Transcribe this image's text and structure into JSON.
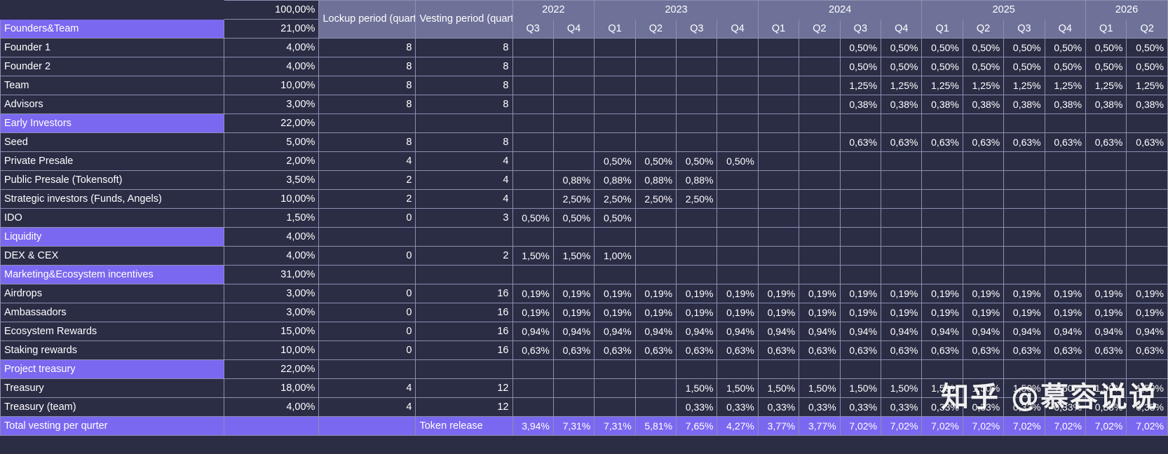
{
  "header": {
    "total_label": "100,00%",
    "lockup_label": "Lockup period (quarters)",
    "vesting_label": "Vesting period (quarters)",
    "years": [
      {
        "label": "2022",
        "span": 2
      },
      {
        "label": "2023",
        "span": 4
      },
      {
        "label": "2024",
        "span": 4
      },
      {
        "label": "2025",
        "span": 4
      },
      {
        "label": "2026",
        "span": 2
      }
    ],
    "quarters": [
      "Q3",
      "Q4",
      "Q1",
      "Q2",
      "Q3",
      "Q4",
      "Q1",
      "Q2",
      "Q3",
      "Q4",
      "Q1",
      "Q2",
      "Q3",
      "Q4",
      "Q1",
      "Q2"
    ]
  },
  "colors": {
    "accent": "#7b68f0",
    "header_band": "#6e7299",
    "cell_bg": "#2b2d45",
    "grid_line": "#8b8fb0"
  },
  "watermark": "知乎 @慕容说说",
  "total_row": {
    "label": "Total vesting per qurter",
    "allocation": "",
    "lockup": "",
    "vesting": "Token release",
    "quarters": [
      "3,94%",
      "7,31%",
      "7,31%",
      "5,81%",
      "7,65%",
      "4,27%",
      "3,77%",
      "3,77%",
      "7,02%",
      "7,02%",
      "7,02%",
      "7,02%",
      "7,02%",
      "7,02%",
      "7,02%",
      "7,02%"
    ]
  },
  "rows": [
    {
      "type": "category",
      "label": "Founders&Team",
      "allocation": "21,00%",
      "lockup": "",
      "vesting": "",
      "quarters": [
        "",
        "",
        "",
        "",
        "",
        "",
        "",
        "",
        "",
        "",
        "",
        "",
        "",
        "",
        "",
        ""
      ]
    },
    {
      "type": "item",
      "label": "Founder 1",
      "allocation": "4,00%",
      "lockup": "8",
      "vesting": "8",
      "quarters": [
        "",
        "",
        "",
        "",
        "",
        "",
        "",
        "",
        "0,50%",
        "0,50%",
        "0,50%",
        "0,50%",
        "0,50%",
        "0,50%",
        "0,50%",
        "0,50%"
      ]
    },
    {
      "type": "item",
      "label": "Founder 2",
      "allocation": "4,00%",
      "lockup": "8",
      "vesting": "8",
      "quarters": [
        "",
        "",
        "",
        "",
        "",
        "",
        "",
        "",
        "0,50%",
        "0,50%",
        "0,50%",
        "0,50%",
        "0,50%",
        "0,50%",
        "0,50%",
        "0,50%"
      ]
    },
    {
      "type": "item",
      "label": "Team",
      "allocation": "10,00%",
      "lockup": "8",
      "vesting": "8",
      "quarters": [
        "",
        "",
        "",
        "",
        "",
        "",
        "",
        "",
        "1,25%",
        "1,25%",
        "1,25%",
        "1,25%",
        "1,25%",
        "1,25%",
        "1,25%",
        "1,25%"
      ]
    },
    {
      "type": "item",
      "label": "Advisors",
      "allocation": "3,00%",
      "lockup": "8",
      "vesting": "8",
      "quarters": [
        "",
        "",
        "",
        "",
        "",
        "",
        "",
        "",
        "0,38%",
        "0,38%",
        "0,38%",
        "0,38%",
        "0,38%",
        "0,38%",
        "0,38%",
        "0,38%"
      ]
    },
    {
      "type": "category",
      "label": "Early Investors",
      "allocation": "22,00%",
      "lockup": "",
      "vesting": "",
      "quarters": [
        "",
        "",
        "",
        "",
        "",
        "",
        "",
        "",
        "",
        "",
        "",
        "",
        "",
        "",
        "",
        ""
      ]
    },
    {
      "type": "item",
      "label": "Seed",
      "allocation": "5,00%",
      "lockup": "8",
      "vesting": "8",
      "quarters": [
        "",
        "",
        "",
        "",
        "",
        "",
        "",
        "",
        "0,63%",
        "0,63%",
        "0,63%",
        "0,63%",
        "0,63%",
        "0,63%",
        "0,63%",
        "0,63%"
      ]
    },
    {
      "type": "item",
      "label": "Private Presale",
      "allocation": "2,00%",
      "lockup": "4",
      "vesting": "4",
      "quarters": [
        "",
        "",
        "0,50%",
        "0,50%",
        "0,50%",
        "0,50%",
        "",
        "",
        "",
        "",
        "",
        "",
        "",
        "",
        "",
        ""
      ]
    },
    {
      "type": "item",
      "label": "Public Presale  (Tokensoft)",
      "allocation": "3,50%",
      "lockup": "2",
      "vesting": "4",
      "quarters": [
        "",
        "0,88%",
        "0,88%",
        "0,88%",
        "0,88%",
        "",
        "",
        "",
        "",
        "",
        "",
        "",
        "",
        "",
        "",
        ""
      ]
    },
    {
      "type": "item",
      "label": "Strategic investors (Funds, Angels)",
      "allocation": "10,00%",
      "lockup": "2",
      "vesting": "4",
      "quarters": [
        "",
        "2,50%",
        "2,50%",
        "2,50%",
        "2,50%",
        "",
        "",
        "",
        "",
        "",
        "",
        "",
        "",
        "",
        "",
        ""
      ]
    },
    {
      "type": "item",
      "label": "IDO",
      "allocation": "1,50%",
      "lockup": "0",
      "vesting": "3",
      "quarters": [
        "0,50%",
        "0,50%",
        "0,50%",
        "",
        "",
        "",
        "",
        "",
        "",
        "",
        "",
        "",
        "",
        "",
        "",
        ""
      ]
    },
    {
      "type": "category",
      "label": "Liquidity",
      "allocation": "4,00%",
      "lockup": "",
      "vesting": "",
      "quarters": [
        "",
        "",
        "",
        "",
        "",
        "",
        "",
        "",
        "",
        "",
        "",
        "",
        "",
        "",
        "",
        ""
      ]
    },
    {
      "type": "item",
      "label": "DEX & CEX",
      "allocation": "4,00%",
      "lockup": "0",
      "vesting": "2",
      "quarters": [
        "1,50%",
        "1,50%",
        "1,00%",
        "",
        "",
        "",
        "",
        "",
        "",
        "",
        "",
        "",
        "",
        "",
        "",
        ""
      ]
    },
    {
      "type": "category",
      "label": "Marketing&Ecosystem incentives",
      "allocation": "31,00%",
      "lockup": "",
      "vesting": "",
      "quarters": [
        "",
        "",
        "",
        "",
        "",
        "",
        "",
        "",
        "",
        "",
        "",
        "",
        "",
        "",
        "",
        ""
      ]
    },
    {
      "type": "item",
      "label": "Airdrops",
      "allocation": "3,00%",
      "lockup": "0",
      "vesting": "16",
      "quarters": [
        "0,19%",
        "0,19%",
        "0,19%",
        "0,19%",
        "0,19%",
        "0,19%",
        "0,19%",
        "0,19%",
        "0,19%",
        "0,19%",
        "0,19%",
        "0,19%",
        "0,19%",
        "0,19%",
        "0,19%",
        "0,19%"
      ]
    },
    {
      "type": "item",
      "label": "Ambassadors",
      "allocation": "3,00%",
      "lockup": "0",
      "vesting": "16",
      "quarters": [
        "0,19%",
        "0,19%",
        "0,19%",
        "0,19%",
        "0,19%",
        "0,19%",
        "0,19%",
        "0,19%",
        "0,19%",
        "0,19%",
        "0,19%",
        "0,19%",
        "0,19%",
        "0,19%",
        "0,19%",
        "0,19%"
      ]
    },
    {
      "type": "item",
      "label": "Ecosystem Rewards",
      "allocation": "15,00%",
      "lockup": "0",
      "vesting": "16",
      "quarters": [
        "0,94%",
        "0,94%",
        "0,94%",
        "0,94%",
        "0,94%",
        "0,94%",
        "0,94%",
        "0,94%",
        "0,94%",
        "0,94%",
        "0,94%",
        "0,94%",
        "0,94%",
        "0,94%",
        "0,94%",
        "0,94%"
      ]
    },
    {
      "type": "item",
      "label": "Staking rewards",
      "allocation": "10,00%",
      "lockup": "0",
      "vesting": "16",
      "quarters": [
        "0,63%",
        "0,63%",
        "0,63%",
        "0,63%",
        "0,63%",
        "0,63%",
        "0,63%",
        "0,63%",
        "0,63%",
        "0,63%",
        "0,63%",
        "0,63%",
        "0,63%",
        "0,63%",
        "0,63%",
        "0,63%"
      ]
    },
    {
      "type": "category",
      "label": "Project treasury",
      "allocation": "22,00%",
      "lockup": "",
      "vesting": "",
      "quarters": [
        "",
        "",
        "",
        "",
        "",
        "",
        "",
        "",
        "",
        "",
        "",
        "",
        "",
        "",
        "",
        ""
      ]
    },
    {
      "type": "item",
      "label": "Treasury",
      "allocation": "18,00%",
      "lockup": "4",
      "vesting": "12",
      "quarters": [
        "",
        "",
        "",
        "",
        "1,50%",
        "1,50%",
        "1,50%",
        "1,50%",
        "1,50%",
        "1,50%",
        "1,50%",
        "1,50%",
        "1,50%",
        "1,50%",
        "1,50%",
        "1,50%"
      ]
    },
    {
      "type": "item",
      "label": "Treasury (team)",
      "allocation": "4,00%",
      "lockup": "4",
      "vesting": "12",
      "quarters": [
        "",
        "",
        "",
        "",
        "0,33%",
        "0,33%",
        "0,33%",
        "0,33%",
        "0,33%",
        "0,33%",
        "0,33%",
        "0,33%",
        "0,33%",
        "0,33%",
        "0,33%",
        "0,33%"
      ]
    }
  ]
}
